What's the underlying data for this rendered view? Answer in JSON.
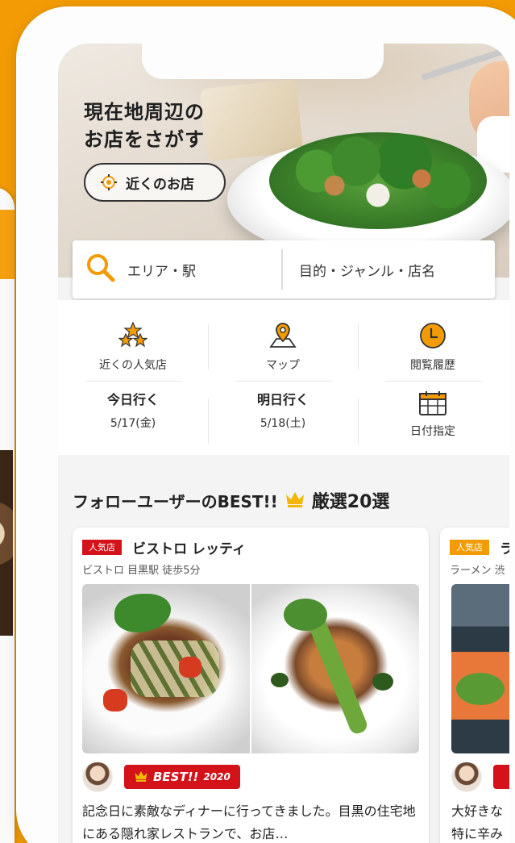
{
  "hero": {
    "title": "現在地周辺の\nお店をさがす",
    "nearby_button": "近くのお店"
  },
  "search": {
    "area_placeholder": "エリア・駅",
    "keyword_placeholder": "目的・ジャンル・店名"
  },
  "quick_menu": {
    "popular": "近くの人気店",
    "map": "マップ",
    "history": "閲覧履歴",
    "today": "今日行く",
    "today_date": "5/17(金)",
    "tomorrow": "明日行く",
    "tomorrow_date": "5/18(土)",
    "date_select": "日付指定"
  },
  "section": {
    "title_prefix": "フォローユーザーのBEST!!",
    "title_suffix": "厳選20選"
  },
  "cards": [
    {
      "tag": "人気店",
      "name": "ビストロ レッティ",
      "meta": "ビストロ  目黒駅 徒歩5分",
      "best_label": "BEST!!",
      "best_year": "2020",
      "comment": "記念日に素敵なディナーに行ってきました。目黒の住宅地にある隠れ家レストランで、お店…"
    },
    {
      "tag": "人気店",
      "name": "ラ",
      "meta": "ラーメン  渋",
      "comment": "大好きな\n特に辛み"
    }
  ],
  "colors": {
    "brand_orange": "#f29b05",
    "badge_red": "#d3121a"
  }
}
